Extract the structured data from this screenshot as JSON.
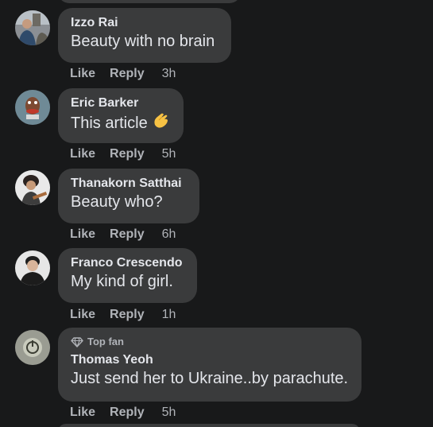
{
  "labels": {
    "like": "Like",
    "reply": "Reply"
  },
  "comments": [
    {
      "author": "Izzo Rai",
      "text": "Beauty with no brain",
      "time": "3h"
    },
    {
      "author": "Eric Barker",
      "text": "This article",
      "emoji": "pinching-hand-icon",
      "time": "5h"
    },
    {
      "author": "Thanakorn Satthai",
      "text": "Beauty who?",
      "time": "6h"
    },
    {
      "author": "Franco Crescendo",
      "text": "My kind of girl.",
      "time": "1h"
    },
    {
      "author": "Thomas Yeoh",
      "badge": "Top fan",
      "badge_icon": "diamond-icon",
      "text": "Just send her to Ukraine..by parachute.",
      "time": "5h"
    }
  ],
  "colors": {
    "background": "#18191a",
    "bubble": "#3a3b3c",
    "primary_text": "#e4e6eb",
    "secondary_text": "#b0b3b8"
  }
}
